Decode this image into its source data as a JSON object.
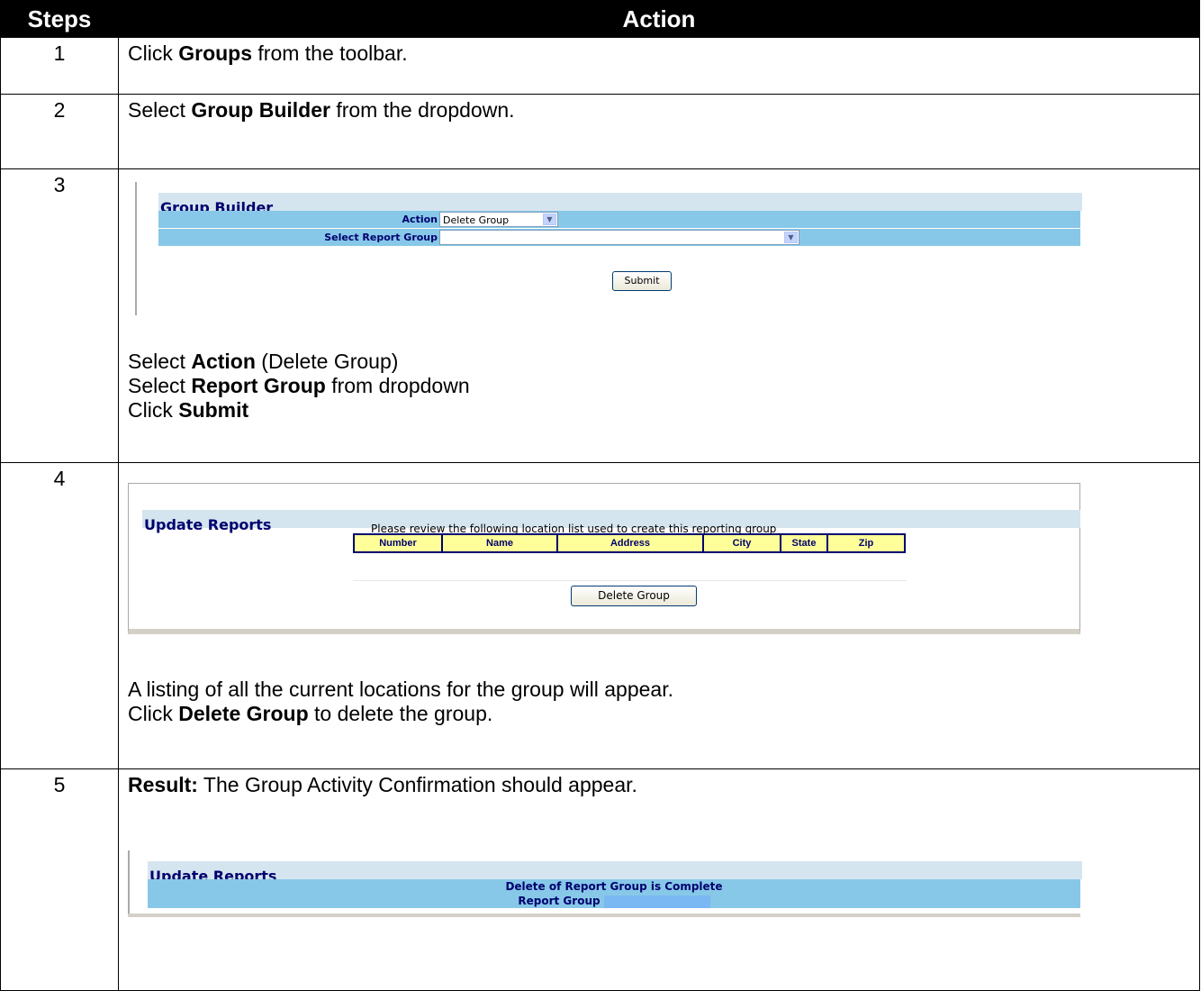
{
  "headers": {
    "steps": "Steps",
    "action": "Action"
  },
  "step1": {
    "num": "1",
    "pre": "Click ",
    "bold": "Groups",
    "post": " from the toolbar."
  },
  "step2": {
    "num": "2",
    "pre": "Select ",
    "bold": "Group Builder",
    "post": " from the dropdown."
  },
  "step3": {
    "num": "3",
    "panel": {
      "title": "Group Builder",
      "action_label": "Action",
      "action_value": "Delete Group",
      "report_group_label": "Select Report Group",
      "report_group_value": "",
      "submit_label": "Submit"
    },
    "lines": [
      {
        "pre": "Select ",
        "bold": "Action",
        "post": " (Delete Group)"
      },
      {
        "pre": "Select ",
        "bold": "Report Group",
        "post": " from dropdown"
      },
      {
        "pre": "Click ",
        "bold": "Submit",
        "post": ""
      }
    ]
  },
  "step4": {
    "num": "4",
    "panel": {
      "title": "Update Reports",
      "note": "Please review the following location list used to create this reporting group",
      "columns": [
        "Number",
        "Name",
        "Address",
        "City",
        "State",
        "Zip"
      ],
      "button_label": "Delete Group"
    },
    "line1": "A listing of all the current locations for the group will appear.",
    "line2": {
      "pre": "Click ",
      "bold": "Delete Group",
      "post": " to delete the group."
    }
  },
  "step5": {
    "num": "5",
    "result_bold": "Result:",
    "result_text": " The Group Activity Confirmation should appear.",
    "panel": {
      "title": "Update Reports",
      "message": "Delete of Report Group is Complete",
      "report_group_label": "Report Group"
    }
  }
}
